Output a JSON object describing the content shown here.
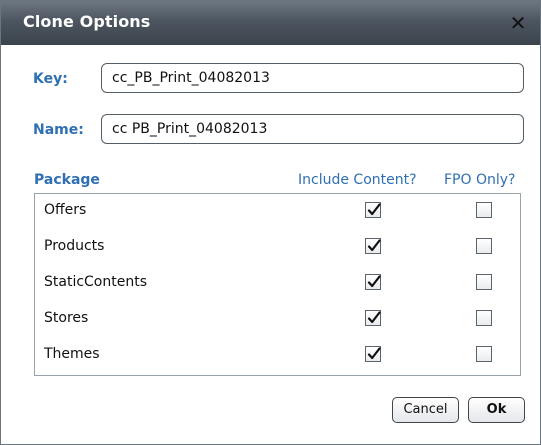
{
  "dialog": {
    "title": "Clone Options",
    "close_glyph": "✕"
  },
  "form": {
    "key": {
      "label": "Key:",
      "value": "cc_PB_Print_04082013"
    },
    "name": {
      "label": "Name:",
      "value": "cc PB_Print_04082013"
    }
  },
  "table": {
    "headers": {
      "package": "Package",
      "include_content": "Include Content?",
      "fpo_only": "FPO Only?"
    },
    "rows": [
      {
        "name": "Offers",
        "include_content": true,
        "fpo_only": false
      },
      {
        "name": "Products",
        "include_content": true,
        "fpo_only": false
      },
      {
        "name": "StaticContents",
        "include_content": true,
        "fpo_only": false
      },
      {
        "name": "Stores",
        "include_content": true,
        "fpo_only": false
      },
      {
        "name": "Themes",
        "include_content": true,
        "fpo_only": false
      }
    ]
  },
  "buttons": {
    "cancel": "Cancel",
    "ok": "Ok"
  },
  "colors": {
    "accent_label": "#2f6fb3",
    "titlebar": "#4d5660"
  },
  "icons": {
    "close": "close-icon",
    "check": "checkmark-icon"
  }
}
